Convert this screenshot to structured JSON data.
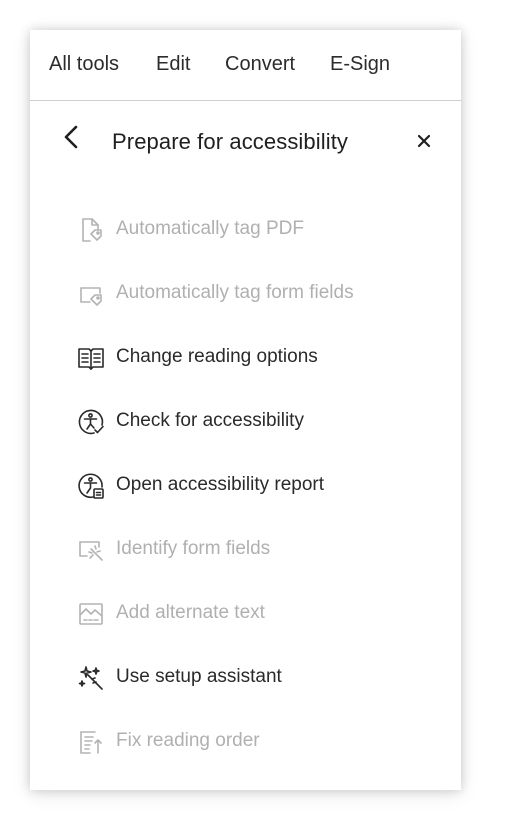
{
  "topnav": {
    "items": [
      {
        "label": "All tools"
      },
      {
        "label": "Edit"
      },
      {
        "label": "Convert"
      },
      {
        "label": "E-Sign"
      }
    ]
  },
  "panel": {
    "title": "Prepare for accessibility",
    "back_icon": "chevron-left-icon",
    "close_icon": "close-icon"
  },
  "tools": [
    {
      "label": "Automatically tag PDF",
      "icon": "auto-tag-pdf-icon",
      "enabled": false
    },
    {
      "label": "Automatically tag form fields",
      "icon": "auto-tag-form-fields-icon",
      "enabled": false
    },
    {
      "label": "Change reading options",
      "icon": "book-icon",
      "enabled": true
    },
    {
      "label": "Check for accessibility",
      "icon": "accessibility-check-icon",
      "enabled": true
    },
    {
      "label": "Open accessibility report",
      "icon": "accessibility-report-icon",
      "enabled": true
    },
    {
      "label": "Identify form fields",
      "icon": "identify-form-fields-icon",
      "enabled": false
    },
    {
      "label": "Add alternate text",
      "icon": "alt-text-image-icon",
      "enabled": false
    },
    {
      "label": "Use setup assistant",
      "icon": "magic-wand-icon",
      "enabled": true
    },
    {
      "label": "Fix reading order",
      "icon": "reading-order-icon",
      "enabled": false
    }
  ],
  "colors": {
    "text_enabled": "#2a2a2a",
    "text_disabled": "#b0b0b0",
    "divider": "#cfcfcf"
  }
}
